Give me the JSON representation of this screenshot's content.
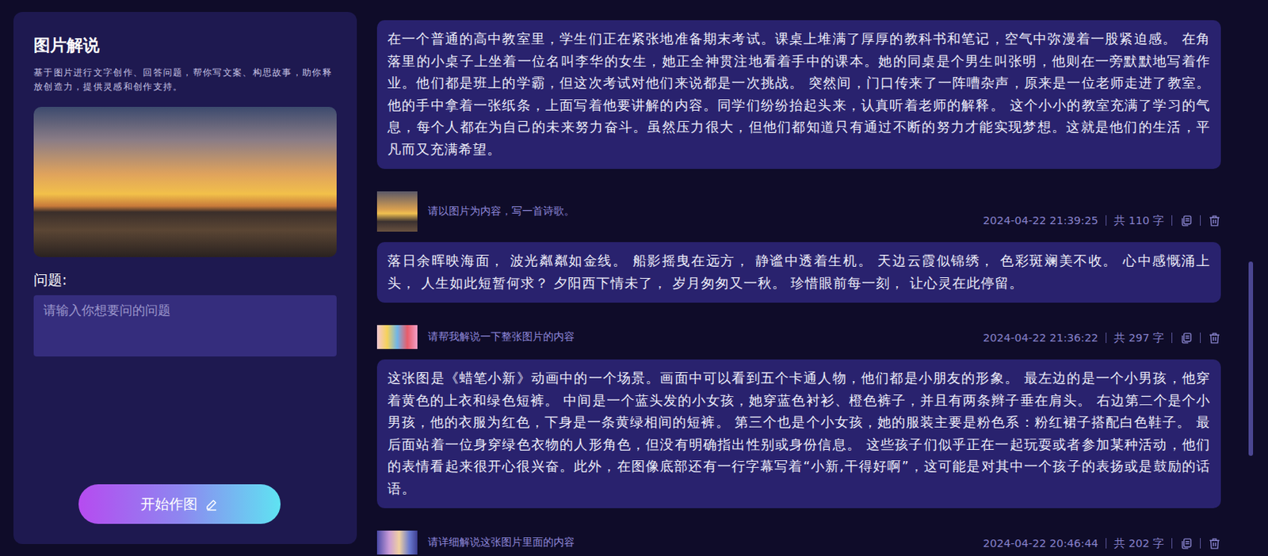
{
  "panel": {
    "title": "图片解说",
    "description": "基于图片进行文字创作、回答问题，帮你写文案、构思故事，助你释放创造力，提供灵感和创作支持。",
    "question_label": "问题:",
    "question": {
      "placeholder": "请输入你想要问的问题"
    },
    "submit": "开始作图"
  },
  "top_answer": "在一个普通的高中教室里，学生们正在紧张地准备期末考试。课桌上堆满了厚厚的教科书和笔记，空气中弥漫着一股紧迫感。 在角落里的小桌子上坐着一位名叫李华的女生，她正全神贯注地看着手中的课本。她的同桌是个男生叫张明，他则在一旁默默地写着作业。他们都是班上的学霸，但这次考试对他们来说都是一次挑战。 突然间，门口传来了一阵嘈杂声，原来是一位老师走进了教室。他的手中拿着一张纸条，上面写着他要讲解的内容。同学们纷纷抬起头来，认真听着老师的解释。 这个小小的教室充满了学习的气息，每个人都在为自己的未来努力奋斗。虽然压力很大，但他们都知道只有通过不断的努力才能实现梦想。这就是他们的生活，平凡而又充满希望。",
  "items": [
    {
      "prompt": "请以图片为内容，写一首诗歌。",
      "time": "2024-04-22 21:39:25",
      "count": "共 110 字",
      "answer": "落日余晖映海面， 波光粼粼如金线。 船影摇曳在远方， 静谧中透着生机。 天边云霞似锦绣， 色彩斑斓美不收。 心中感慨涌上头， 人生如此短暂何求？ 夕阳西下情未了， 岁月匆匆又一秋。 珍惜眼前每一刻， 让心灵在此停留。"
    },
    {
      "prompt": "请帮我解说一下整张图片的内容",
      "time": "2024-04-22 21:36:22",
      "count": "共 297 字",
      "answer": "这张图是《蜡笔小新》动画中的一个场景。画面中可以看到五个卡通人物，他们都是小朋友的形象。 最左边的是一个小男孩，他穿着黄色的上衣和绿色短裤。 中间是一个蓝头发的小女孩，她穿蓝色衬衫、橙色裤子，并且有两条辫子垂在肩头。 右边第二个是个小男孩，他的衣服为红色，下身是一条黄绿相间的短裤。 第三个也是个小女孩，她的服装主要是粉色系：粉红裙子搭配白色鞋子。 最后面站着一位身穿绿色衣物的人形角色，但没有明确指出性别或身份信息。 这些孩子们似乎正在一起玩耍或者参加某种活动，他们的表情看起来很开心很兴奋。此外，在图像底部还有一行字幕写着“小新,干得好啊”，这可能是对其中一个孩子的表扬或是鼓励的话语。"
    },
    {
      "prompt": "请详细解说这张图片里面的内容",
      "time": "2024-04-22 20:46:44",
      "count": "共 202 字"
    }
  ],
  "scrollbar": {
    "offset": 0.47,
    "level": 0.35
  }
}
